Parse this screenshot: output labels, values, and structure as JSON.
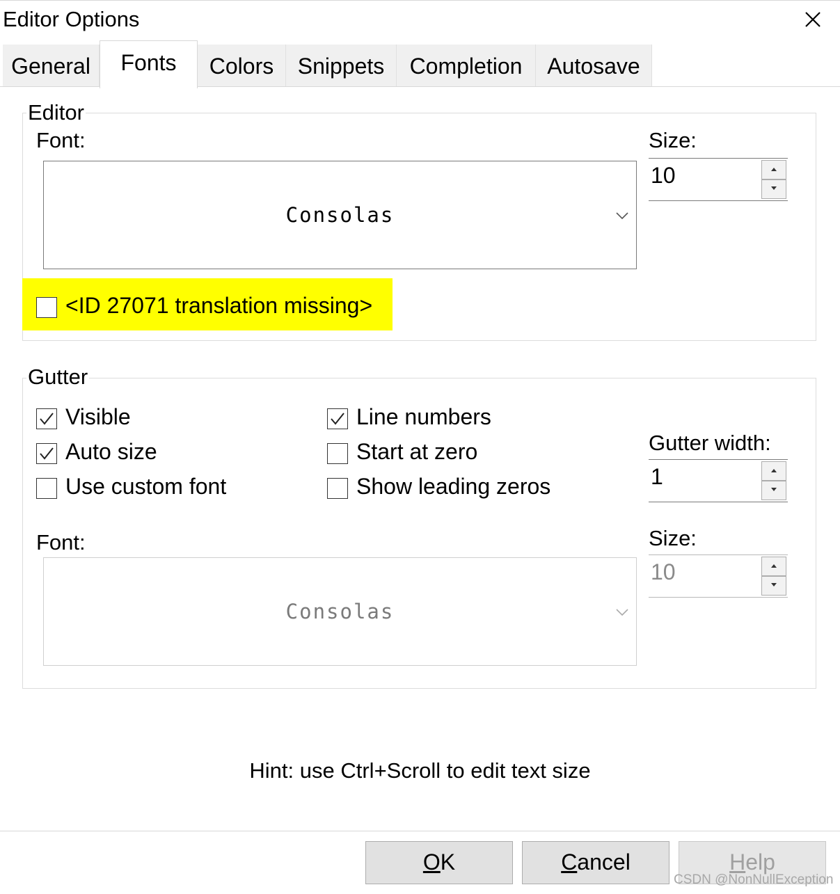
{
  "window": {
    "title": "Editor Options"
  },
  "tabs": [
    {
      "label": "General"
    },
    {
      "label": "Fonts",
      "selected": true
    },
    {
      "label": "Colors"
    },
    {
      "label": "Snippets"
    },
    {
      "label": "Completion"
    },
    {
      "label": "Autosave"
    }
  ],
  "editor": {
    "group_title": "Editor",
    "font_label": "Font:",
    "font_value": "Consolas",
    "size_label": "Size:",
    "size_value": "10",
    "checkbox_label": "<ID 27071 translation missing>",
    "checkbox_checked": false,
    "highlight_color": "#ffff00"
  },
  "gutter": {
    "group_title": "Gutter",
    "checkboxes": [
      {
        "label": "Visible",
        "checked": true
      },
      {
        "label": "Auto size",
        "checked": true
      },
      {
        "label": "Use custom font",
        "checked": false
      },
      {
        "label": "Line numbers",
        "checked": true
      },
      {
        "label": "Start at zero",
        "checked": false
      },
      {
        "label": "Show leading zeros",
        "checked": false
      }
    ],
    "width_label": "Gutter width:",
    "width_value": "1",
    "font_label": "Font:",
    "font_value": "Consolas",
    "size_label": "Size:",
    "size_value": "10"
  },
  "hint": "Hint: use Ctrl+Scroll to edit text size",
  "buttons": {
    "ok": {
      "mnemonic": "O",
      "rest": "K"
    },
    "cancel": {
      "mnemonic": "C",
      "rest": "ancel"
    },
    "help": {
      "mnemonic": "H",
      "rest": "elp",
      "disabled": true
    }
  },
  "watermark": "CSDN @NonNullException",
  "icons": {
    "close": "close-icon",
    "dropdown": "chevron-down-icon",
    "spin_up": "arrow-up-icon",
    "spin_down": "arrow-down-icon",
    "check": "check-icon"
  }
}
